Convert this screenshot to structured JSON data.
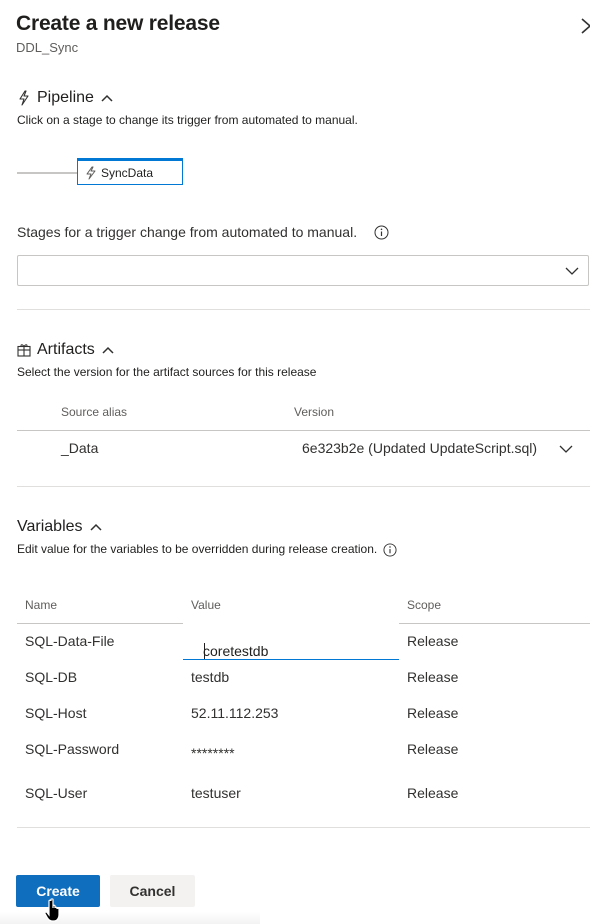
{
  "panel": {
    "title": "Create a new release",
    "subtitle": "DDL_Sync"
  },
  "pipeline": {
    "heading": "Pipeline",
    "description": "Click on a stage to change its trigger from automated to manual.",
    "stage_name": "SyncData",
    "trigger_label": "Stages for a trigger change from automated to manual.",
    "trigger_value": ""
  },
  "artifacts": {
    "heading": "Artifacts",
    "description": "Select the version for the artifact sources for this release",
    "columns": [
      "Source alias",
      "Version"
    ],
    "rows": [
      {
        "source_alias": "_Data",
        "version": "6e323b2e (Updated UpdateScript.sql)"
      }
    ]
  },
  "variables": {
    "heading": "Variables",
    "description": "Edit value for the variables to be overridden during release creation.",
    "columns": [
      "Name",
      "Value",
      "Scope"
    ],
    "rows": [
      {
        "name": "SQL-Data-File",
        "value": "coretestdb",
        "scope": "Release"
      },
      {
        "name": "SQL-DB",
        "value": "testdb",
        "scope": "Release"
      },
      {
        "name": "SQL-Host",
        "value": "52.11.112.253",
        "scope": "Release"
      },
      {
        "name": "SQL-Password",
        "value": "********",
        "scope": "Release"
      },
      {
        "name": "SQL-User",
        "value": "testuser",
        "scope": "Release"
      }
    ]
  },
  "actions": {
    "create_label": "Create",
    "cancel_label": "Cancel"
  },
  "colors": {
    "accent": "#0078d4",
    "primary_button": "#106ebe",
    "divider": "#e1dfdd"
  },
  "icons": {
    "close": "close-icon",
    "pipeline": "lightning-icon",
    "artifacts": "package-icon",
    "info": "info-icon",
    "chevron_up": "chevron-up-icon",
    "chevron_down": "chevron-down-icon"
  }
}
